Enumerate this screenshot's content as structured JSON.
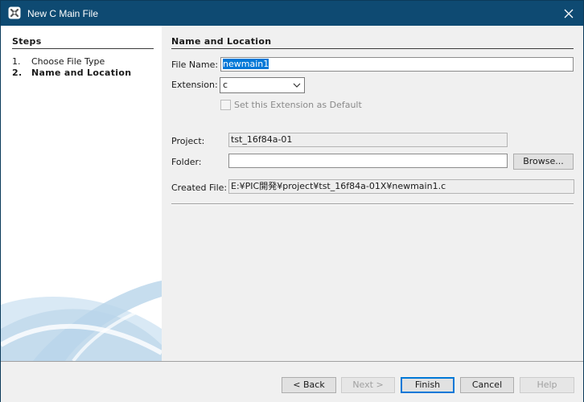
{
  "window": {
    "title": "New C Main File"
  },
  "steps": {
    "heading": "Steps",
    "items": [
      {
        "num": "1.",
        "label": "Choose File Type"
      },
      {
        "num": "2.",
        "label": "Name and Location"
      }
    ]
  },
  "form": {
    "section_title": "Name and Location",
    "file_name_label": "File Name:",
    "file_name_value": "newmain1",
    "extension_label": "Extension:",
    "extension_value": "c",
    "set_default_label": "Set this Extension as Default",
    "project_label": "Project:",
    "project_value": "tst_16f84a-01",
    "folder_label": "Folder:",
    "folder_value": "",
    "browse_label": "Browse...",
    "created_file_label": "Created File:",
    "created_file_value": "E:¥PIC開発¥project¥tst_16f84a-01X¥newmain1.c"
  },
  "buttons": {
    "back": "< Back",
    "next": "Next >",
    "finish": "Finish",
    "cancel": "Cancel",
    "help": "Help"
  },
  "icons": {
    "app": "netbeans-x-icon",
    "close": "close-icon",
    "chevron": "chevron-down-icon"
  },
  "colors": {
    "titlebar": "#0e4a72",
    "selection": "#0078d7"
  }
}
